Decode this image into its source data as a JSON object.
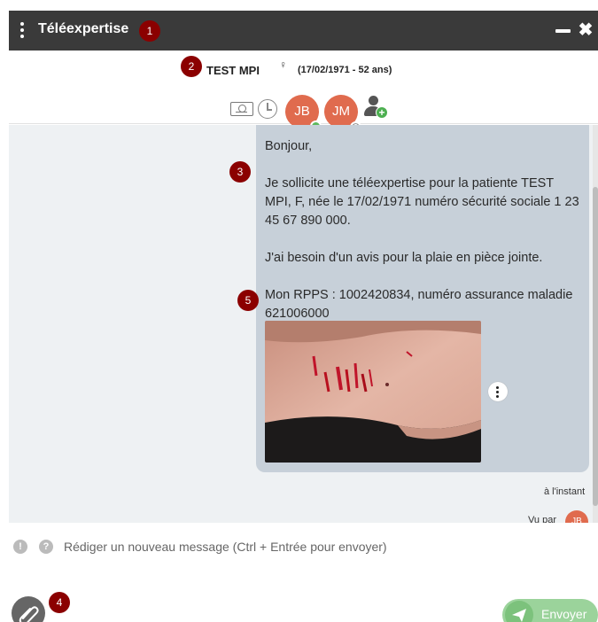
{
  "window": {
    "title": "Téléexpertise",
    "minimize_icon": "minimize-icon",
    "close_icon": "close-icon"
  },
  "annotations": [
    "1",
    "2",
    "3",
    "4",
    "5"
  ],
  "patient": {
    "name": "TEST MPI",
    "sex_symbol": "♀",
    "dob_age": "(17/02/1971 - 52 ans)"
  },
  "participants": [
    {
      "initials": "JB",
      "status": "online",
      "color": "#e06b4e"
    },
    {
      "initials": "JM",
      "status": "unknown",
      "status_symbol": "?",
      "color": "#e06b4e"
    }
  ],
  "toolbar_icons": [
    "id-card-icon",
    "history-clock-icon",
    "add-participant-icon"
  ],
  "message": {
    "text": "Bonjour,\n\nJe sollicite une téléexpertise pour la patiente TEST MPI, F, née le 17/02/1971 numéro sécurité sociale 1 23 45 67 890 000.\n\nJ'ai besoin d'un avis pour la plaie en pièce jointe.\n\nMon RPPS : 1002420834, numéro assurance maladie 621006000",
    "attachment": "wound-photo",
    "timestamp": "à l'instant",
    "seen_by_label": "Vu par",
    "seen_by_initials": "JB"
  },
  "composer": {
    "placeholder": "Rédiger un nouveau message (Ctrl + Entrée pour envoyer)",
    "value": "",
    "warn_symbol": "!",
    "help_symbol": "?",
    "send_label": "Envoyer",
    "plus_symbol": "+",
    "close_symbol": "✖"
  },
  "colors": {
    "titlebar": "#3a3a3a",
    "badge": "#8b0000",
    "avatar": "#e06b4e",
    "bubble": "#c7d0d9",
    "send": "#9bd39b"
  }
}
